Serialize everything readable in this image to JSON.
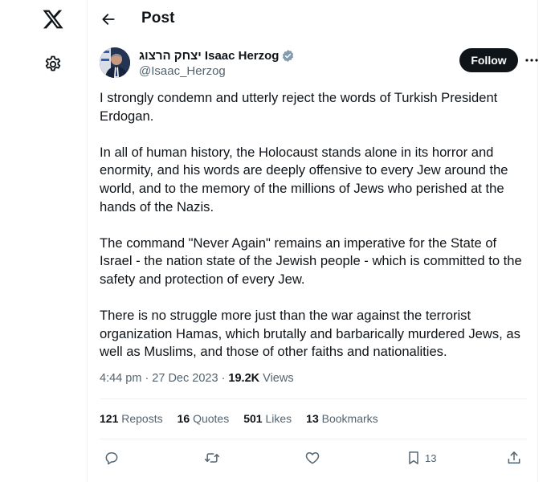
{
  "header": {
    "title": "Post"
  },
  "author": {
    "display_name": "יצחק הרצוג Isaac Herzog",
    "handle": "@Isaac_Herzog",
    "follow_label": "Follow"
  },
  "tweet": {
    "paragraphs": [
      "I strongly condemn and utterly reject the words of Turkish President Erdogan.",
      "In all of human history, the Holocaust stands alone in its horror and enormity, and his words are deeply offensive to every Jew around the world, and to the memory of the millions of Jews who perished at the hands of the Nazis.",
      "The command \"Never Again\" remains an imperative for the State of Israel - the nation state of the Jewish people - which is committed to the safety and protection of every Jew.",
      "There is no struggle more just than the war against the terrorist organization Hamas, which brutally and barbarically murdered Jews, as well as Muslims, and those of other faiths and nationalities."
    ],
    "time": "4:44 pm",
    "date": "27 Dec 2023",
    "views_count": "19.2K",
    "views_label": "Views"
  },
  "stats": {
    "reposts_count": "121",
    "reposts_label": "Reposts",
    "quotes_count": "16",
    "quotes_label": "Quotes",
    "likes_count": "501",
    "likes_label": "Likes",
    "bookmarks_count": "13",
    "bookmarks_label": "Bookmarks"
  },
  "actions": {
    "bookmark_count": "13"
  },
  "icons": {
    "logo": "x-logo-icon",
    "settings": "gear-icon",
    "back": "arrow-left-icon",
    "verified": "verified-badge-icon",
    "more": "more-horizontal-icon",
    "reply": "reply-icon",
    "repost": "repost-icon",
    "like": "heart-icon",
    "bookmark": "bookmark-icon",
    "share": "share-icon"
  },
  "colors": {
    "text": "#0f1419",
    "secondary": "#536471",
    "verified": "#829aab",
    "border": "#eff3f4"
  }
}
